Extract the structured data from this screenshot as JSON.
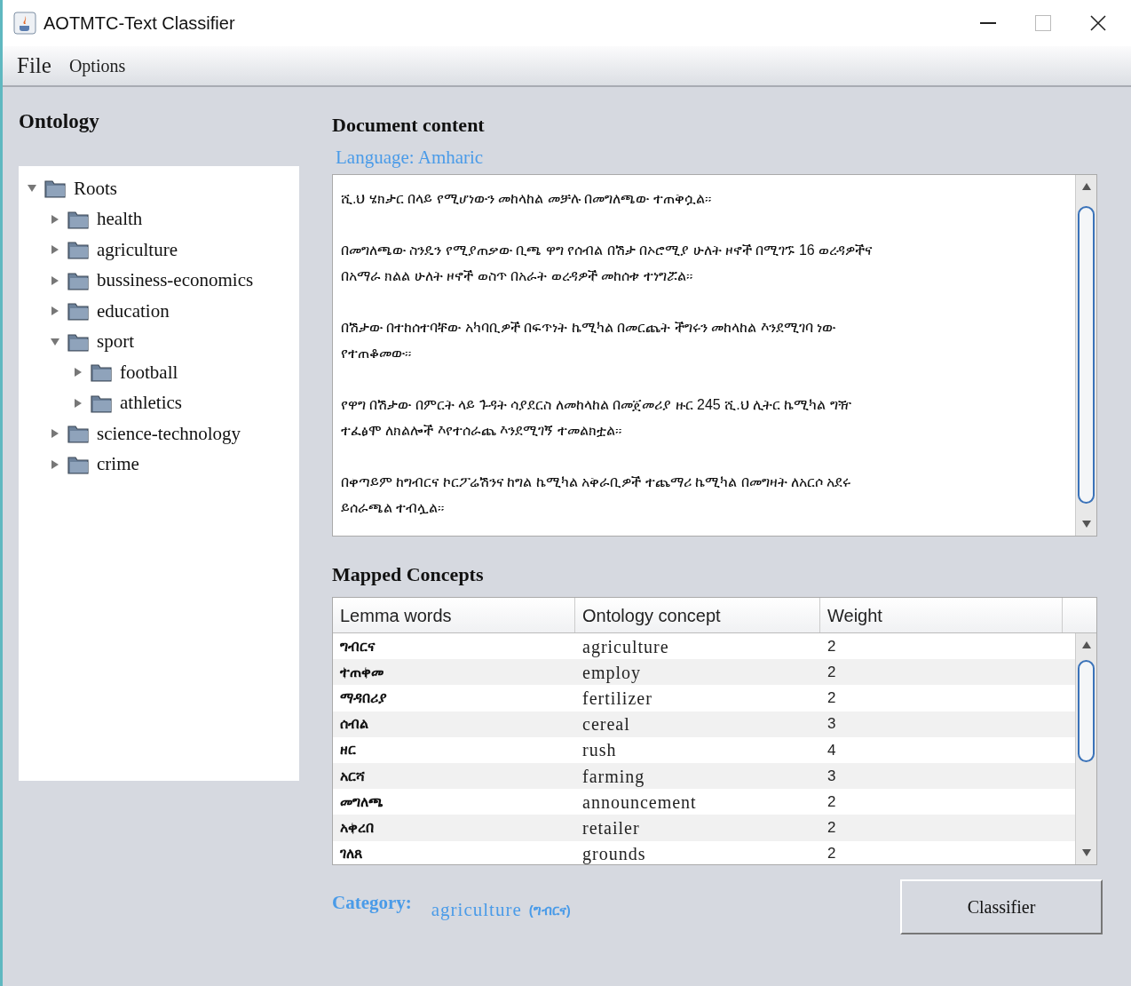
{
  "window": {
    "title": "AOTMTC-Text Classifier"
  },
  "menu": [
    "File",
    "Options"
  ],
  "ontology": {
    "title": "Ontology",
    "tree": [
      {
        "label": "Roots",
        "expanded": true,
        "children": [
          {
            "label": "health",
            "expanded": false
          },
          {
            "label": "agriculture",
            "expanded": false
          },
          {
            "label": "bussiness-economics",
            "expanded": false
          },
          {
            "label": "education",
            "expanded": false
          },
          {
            "label": "sport",
            "expanded": true,
            "children": [
              {
                "label": "football",
                "expanded": false
              },
              {
                "label": "athletics",
                "expanded": false
              }
            ]
          },
          {
            "label": "science-technology",
            "expanded": false
          },
          {
            "label": "crime",
            "expanded": false
          }
        ]
      }
    ]
  },
  "document": {
    "title": "Document content",
    "language": "Language: Amharic",
    "paragraphs": [
      [
        "ሺ.ህ ሄክታር በላይ የሚሆነውን መከላከል መቻሉ በመግለጫው ተጠቅሷል።"
      ],
      [
        "በመግለጫው ስንዴን የሚያጠቃው ቢጫ ዋግ የሰብል በሽታ በኦሮሚያ ሁለት ዞኖች በሚገኙ 16 ወረዳዎችና",
        "በአማራ ክልል ሁለት ዞኖች ወስጥ በአራት ወረዳዎች መከሰቱ ተነግሯል።"
      ],
      [
        "በሽታው በተከሰተባቸው አካባቢዎች በፍጥነት ኬሚካል በመርጨት ችግሩን መከላከል እንደሚገባ ነው",
        "የተጠቆመው።"
      ],
      [
        "የዋግ በሽታው በምርት ላይ ጉዳት ሳያደርስ ለመከላከል በመጀመሪያ ዙር 245 ሺ.ህ ሊትር ኬሚካል ግዥ",
        "ተፈፅሞ ለክልሎች እየተሰራጨ እንደሚገኝ ተመልክቷል።"
      ],
      [
        "በቀጣይም ከግብርና ኮርፖሬሽንና ከግል ኬሚካል አቅራቢዎች ተጨማሪ ኬሚካል በመግዛት ለአርሶ አደሩ",
        "ይሰራጫል ተብሏል።"
      ]
    ]
  },
  "mapped": {
    "title": "Mapped Concepts",
    "columns": [
      "Lemma words",
      "Ontology concept",
      "Weight"
    ],
    "rows": [
      [
        "ግብርና",
        "agriculture",
        "2"
      ],
      [
        "ተጠቀመ",
        "employ",
        "2"
      ],
      [
        "ማዳበሪያ",
        "fertilizer",
        "2"
      ],
      [
        "ሰብል",
        "cereal",
        "3"
      ],
      [
        "ዘር",
        "rush",
        "4"
      ],
      [
        "አርሻ",
        "farming",
        "3"
      ],
      [
        "መግለጫ",
        "announcement",
        "2"
      ],
      [
        "አቀረበ",
        "retailer",
        "2"
      ],
      [
        "ገለጸ",
        "grounds",
        "2"
      ]
    ]
  },
  "category": {
    "label": "Category:",
    "value": "agriculture",
    "lemma": "(ግብርና)"
  },
  "buttons": [
    "Classifier"
  ]
}
